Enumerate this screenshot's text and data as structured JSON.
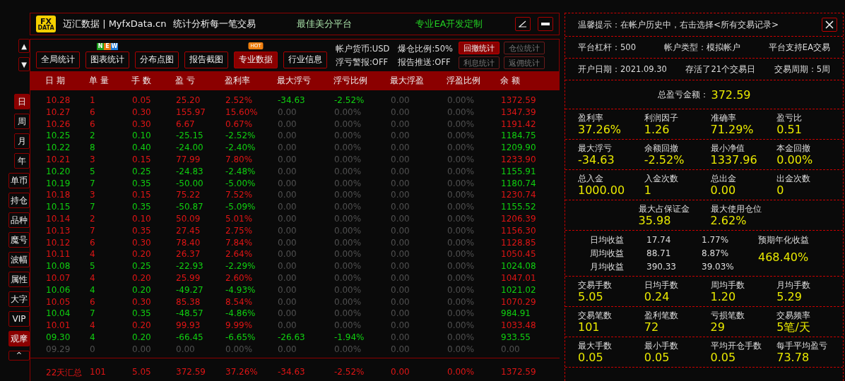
{
  "sidebar": {
    "scroll_up": "▲",
    "scroll_down": "▼",
    "collapse": "^",
    "items": [
      {
        "label": "日",
        "kind": "period",
        "selected": true
      },
      {
        "label": "周",
        "kind": "period",
        "selected": false
      },
      {
        "label": "月",
        "kind": "period",
        "selected": false
      },
      {
        "label": "年",
        "kind": "period",
        "selected": false
      },
      {
        "label": "单币",
        "kind": "tool",
        "selected": false
      },
      {
        "label": "持仓",
        "kind": "tool",
        "selected": false
      },
      {
        "label": "品种",
        "kind": "tool",
        "selected": false
      },
      {
        "label": "魔号",
        "kind": "tool",
        "selected": false
      },
      {
        "label": "波幅",
        "kind": "tool",
        "selected": false
      },
      {
        "label": "属性",
        "kind": "tool",
        "selected": false
      },
      {
        "label": "大字",
        "kind": "tool",
        "selected": false
      },
      {
        "label": "VIP",
        "kind": "tool",
        "selected": false
      },
      {
        "label": "观摩",
        "kind": "tool",
        "selected": true
      }
    ]
  },
  "header": {
    "logo": {
      "top": "FX",
      "bottom": "DATA"
    },
    "brand": "迈汇数据 | MyfxData.cn",
    "tagline": "统计分析每一笔交易",
    "slogan": "最佳美分平台",
    "promo": "专业EA开发定制"
  },
  "toolbar": {
    "buttons": [
      {
        "label": "全局统计",
        "selected": false
      },
      {
        "label": "图表统计",
        "selected": false,
        "badges": [
          {
            "text": "N",
            "color": "#1aa01a"
          },
          {
            "text": "E",
            "color": "#e87a10"
          },
          {
            "text": "W",
            "color": "#1a7ad8"
          }
        ]
      },
      {
        "label": "分布点图",
        "selected": false
      },
      {
        "label": "报告截图",
        "selected": false
      },
      {
        "label": "专业数据",
        "selected": true,
        "hot": "HOT"
      },
      {
        "label": "行业信息",
        "selected": false
      }
    ],
    "info": [
      "帐户货币:USD",
      "爆仓比例:50%",
      "浮亏警报:OFF",
      "报告推送:OFF"
    ],
    "stat_buttons": [
      {
        "label": "回撤统计",
        "active": true
      },
      {
        "label": "仓位统计",
        "active": false
      },
      {
        "label": "利息统计",
        "active": false
      },
      {
        "label": "返佣统计",
        "active": false
      }
    ]
  },
  "table": {
    "columns": [
      "日 期",
      "单 量",
      "手 数",
      "盈 亏",
      "盈利率",
      "最大浮亏",
      "浮亏比例",
      "最大浮盈",
      "浮盈比例",
      "余 额"
    ],
    "rows": [
      {
        "kind": "profit",
        "float_loss": true,
        "cells": [
          "10.28",
          "1",
          "0.05",
          "25.20",
          "2.52%",
          "-34.63",
          "-2.52%",
          "0.00",
          "0.00%",
          "1372.59"
        ]
      },
      {
        "kind": "profit",
        "float_loss": false,
        "cells": [
          "10.27",
          "6",
          "0.30",
          "155.97",
          "15.60%",
          "0.00",
          "0.00%",
          "0.00",
          "0.00%",
          "1347.39"
        ]
      },
      {
        "kind": "profit",
        "float_loss": false,
        "cells": [
          "10.26",
          "6",
          "0.30",
          "6.67",
          "0.67%",
          "0.00",
          "0.00%",
          "0.00",
          "0.00%",
          "1191.42"
        ]
      },
      {
        "kind": "loss",
        "float_loss": false,
        "cells": [
          "10.25",
          "2",
          "0.10",
          "-25.15",
          "-2.52%",
          "0.00",
          "0.00%",
          "0.00",
          "0.00%",
          "1184.75"
        ]
      },
      {
        "kind": "loss",
        "float_loss": false,
        "cells": [
          "10.22",
          "8",
          "0.40",
          "-24.00",
          "-2.40%",
          "0.00",
          "0.00%",
          "0.00",
          "0.00%",
          "1209.90"
        ]
      },
      {
        "kind": "profit",
        "float_loss": false,
        "cells": [
          "10.21",
          "3",
          "0.15",
          "77.99",
          "7.80%",
          "0.00",
          "0.00%",
          "0.00",
          "0.00%",
          "1233.90"
        ]
      },
      {
        "kind": "loss",
        "float_loss": false,
        "cells": [
          "10.20",
          "5",
          "0.25",
          "-24.83",
          "-2.48%",
          "0.00",
          "0.00%",
          "0.00",
          "0.00%",
          "1155.91"
        ]
      },
      {
        "kind": "loss",
        "float_loss": false,
        "cells": [
          "10.19",
          "7",
          "0.35",
          "-50.00",
          "-5.00%",
          "0.00",
          "0.00%",
          "0.00",
          "0.00%",
          "1180.74"
        ]
      },
      {
        "kind": "profit",
        "float_loss": false,
        "cells": [
          "10.18",
          "3",
          "0.15",
          "75.22",
          "7.52%",
          "0.00",
          "0.00%",
          "0.00",
          "0.00%",
          "1230.74"
        ]
      },
      {
        "kind": "loss",
        "float_loss": false,
        "cells": [
          "10.15",
          "7",
          "0.35",
          "-50.87",
          "-5.09%",
          "0.00",
          "0.00%",
          "0.00",
          "0.00%",
          "1155.52"
        ]
      },
      {
        "kind": "profit",
        "float_loss": false,
        "cells": [
          "10.14",
          "2",
          "0.10",
          "50.09",
          "5.01%",
          "0.00",
          "0.00%",
          "0.00",
          "0.00%",
          "1206.39"
        ]
      },
      {
        "kind": "profit",
        "float_loss": false,
        "cells": [
          "10.13",
          "7",
          "0.35",
          "27.45",
          "2.75%",
          "0.00",
          "0.00%",
          "0.00",
          "0.00%",
          "1156.30"
        ]
      },
      {
        "kind": "profit",
        "float_loss": false,
        "cells": [
          "10.12",
          "6",
          "0.30",
          "78.40",
          "7.84%",
          "0.00",
          "0.00%",
          "0.00",
          "0.00%",
          "1128.85"
        ]
      },
      {
        "kind": "profit",
        "float_loss": false,
        "cells": [
          "10.11",
          "4",
          "0.20",
          "26.37",
          "2.64%",
          "0.00",
          "0.00%",
          "0.00",
          "0.00%",
          "1050.45"
        ]
      },
      {
        "kind": "loss",
        "float_loss": false,
        "cells": [
          "10.08",
          "5",
          "0.25",
          "-22.93",
          "-2.29%",
          "0.00",
          "0.00%",
          "0.00",
          "0.00%",
          "1024.08"
        ]
      },
      {
        "kind": "profit",
        "float_loss": false,
        "cells": [
          "10.07",
          "4",
          "0.20",
          "25.99",
          "2.60%",
          "0.00",
          "0.00%",
          "0.00",
          "0.00%",
          "1047.01"
        ]
      },
      {
        "kind": "loss",
        "float_loss": false,
        "cells": [
          "10.06",
          "4",
          "0.20",
          "-49.27",
          "-4.93%",
          "0.00",
          "0.00%",
          "0.00",
          "0.00%",
          "1021.02"
        ]
      },
      {
        "kind": "profit",
        "float_loss": false,
        "cells": [
          "10.05",
          "6",
          "0.30",
          "85.38",
          "8.54%",
          "0.00",
          "0.00%",
          "0.00",
          "0.00%",
          "1070.29"
        ]
      },
      {
        "kind": "loss",
        "float_loss": false,
        "cells": [
          "10.04",
          "7",
          "0.35",
          "-48.57",
          "-4.86%",
          "0.00",
          "0.00%",
          "0.00",
          "0.00%",
          "984.91"
        ]
      },
      {
        "kind": "profit",
        "float_loss": false,
        "cells": [
          "10.01",
          "4",
          "0.20",
          "99.93",
          "9.99%",
          "0.00",
          "0.00%",
          "0.00",
          "0.00%",
          "1033.48"
        ]
      },
      {
        "kind": "loss",
        "float_loss": true,
        "cells": [
          "09.30",
          "4",
          "0.20",
          "-66.45",
          "-6.65%",
          "-26.63",
          "-1.94%",
          "0.00",
          "0.00%",
          "933.55"
        ]
      },
      {
        "kind": "flat",
        "float_loss": false,
        "cells": [
          "09.29",
          "0",
          "0.00",
          "0.00",
          "0.00%",
          "0.00",
          "0.00%",
          "0.00",
          "0.00%",
          "0.00"
        ]
      }
    ],
    "summary": [
      "22天汇总",
      "101",
      "5.05",
      "372.59",
      "37.26%",
      "-34.63",
      "-2.52%",
      "0.00",
      "0.00%",
      "1372.59"
    ]
  },
  "panel": {
    "notice": "温馨提示：在帐户历史中，右击选择<所有交易记录>",
    "info_rows": [
      [
        "平台杠杆：500",
        "帐户类型：模拟帐户",
        "平台支持EA交易"
      ],
      [
        "开户日期：2021.09.30",
        "存活了21个交易日",
        "交易周期：5周"
      ]
    ],
    "total": {
      "label": "总盈亏金额：",
      "value": "372.59"
    },
    "sections": [
      {
        "kind": "stats",
        "items": [
          {
            "label": "盈利率",
            "value": "37.26%"
          },
          {
            "label": "利润因子",
            "value": "1.26"
          },
          {
            "label": "准确率",
            "value": "71.29%"
          },
          {
            "label": "盈亏比",
            "value": "0.51"
          }
        ]
      },
      {
        "kind": "stats",
        "items": [
          {
            "label": "最大浮亏",
            "value": "-34.63"
          },
          {
            "label": "余额回撤",
            "value": "-2.52%"
          },
          {
            "label": "最小净值",
            "value": "1337.96"
          },
          {
            "label": "本金回撤",
            "value": "0.00%"
          }
        ]
      },
      {
        "kind": "stats",
        "items": [
          {
            "label": "总入金",
            "value": "1000.00"
          },
          {
            "label": "入金次数",
            "value": "1"
          },
          {
            "label": "总出金",
            "value": "0.00"
          },
          {
            "label": "出金次数",
            "value": "0"
          }
        ]
      },
      {
        "kind": "stats",
        "items": [
          {
            "label": "最大占保证金",
            "value": "35.98"
          },
          {
            "label": "最大使用仓位",
            "value": "2.62%"
          }
        ]
      },
      {
        "kind": "averages",
        "rows": [
          {
            "label": "日均收益",
            "amount": "17.74",
            "pct": "1.77%"
          },
          {
            "label": "周均收益",
            "amount": "88.71",
            "pct": "8.87%"
          },
          {
            "label": "月均收益",
            "amount": "390.33",
            "pct": "39.03%"
          }
        ],
        "projection": {
          "label": "预期年化收益",
          "value": "468.40%"
        }
      },
      {
        "kind": "stats",
        "items": [
          {
            "label": "交易手数",
            "value": "5.05"
          },
          {
            "label": "日均手数",
            "value": "0.24"
          },
          {
            "label": "周均手数",
            "value": "1.20"
          },
          {
            "label": "月均手数",
            "value": "5.29"
          }
        ]
      },
      {
        "kind": "stats",
        "items": [
          {
            "label": "交易笔数",
            "value": "101"
          },
          {
            "label": "盈利笔数",
            "value": "72"
          },
          {
            "label": "亏损笔数",
            "value": "29"
          },
          {
            "label": "交易频率",
            "value": "5笔/天"
          }
        ]
      },
      {
        "kind": "stats",
        "items": [
          {
            "label": "最大手数",
            "value": "0.05"
          },
          {
            "label": "最小手数",
            "value": "0.05"
          },
          {
            "label": "平均开仓手数",
            "value": "0.05"
          },
          {
            "label": "每手平均盈亏",
            "value": "73.78"
          }
        ]
      }
    ]
  }
}
